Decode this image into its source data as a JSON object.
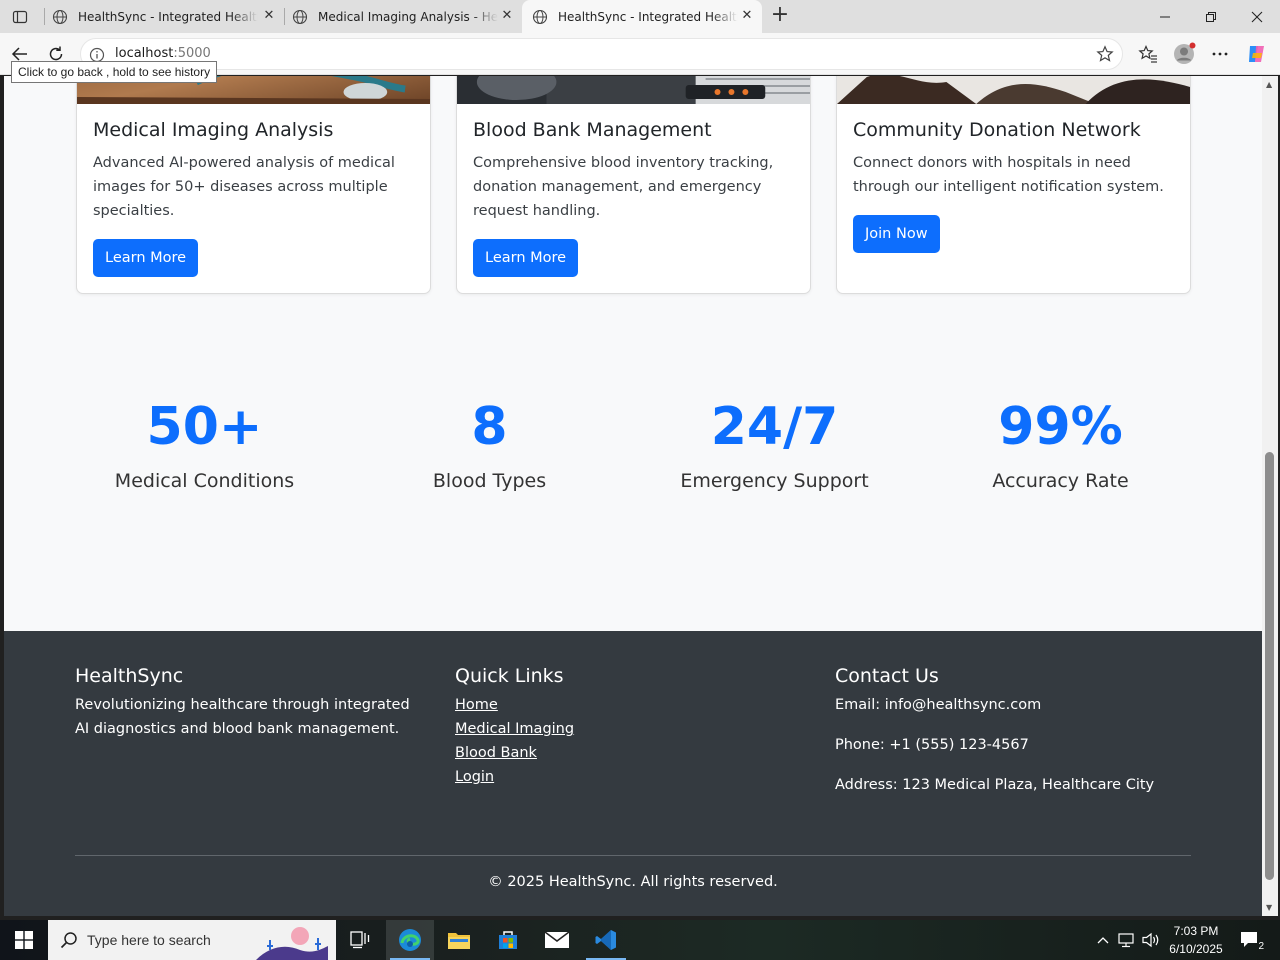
{
  "browser": {
    "tabs": [
      {
        "title": "HealthSync - Integrated Healthcare"
      },
      {
        "title": "Medical Imaging Analysis - HealthSync"
      },
      {
        "title": "HealthSync - Integrated Healthcare"
      }
    ],
    "url_host": "localhost",
    "url_port": ":5000",
    "back_tooltip": "Click to go back , hold to see history"
  },
  "cards": [
    {
      "title": "Medical Imaging Analysis",
      "text": "Advanced AI-powered analysis of medical images for 50+ diseases across multiple specialties.",
      "button": "Learn More"
    },
    {
      "title": "Blood Bank Management",
      "text": "Comprehensive blood inventory tracking, donation management, and emergency request handling.",
      "button": "Learn More"
    },
    {
      "title": "Community Donation Network",
      "text": "Connect donors with hospitals in need through our intelligent notification system.",
      "button": "Join Now"
    }
  ],
  "stats": [
    {
      "value": "50+",
      "label": "Medical Conditions"
    },
    {
      "value": "8",
      "label": "Blood Types"
    },
    {
      "value": "24/7",
      "label": "Emergency Support"
    },
    {
      "value": "99%",
      "label": "Accuracy Rate"
    }
  ],
  "footer": {
    "brand": "HealthSync",
    "tagline": "Revolutionizing healthcare through integrated AI diagnostics and blood bank management.",
    "quick_links_title": "Quick Links",
    "quick_links": [
      "Home",
      "Medical Imaging",
      "Blood Bank",
      "Login"
    ],
    "contact_title": "Contact Us",
    "email": "Email: info@healthsync.com",
    "phone": "Phone: +1 (555) 123-4567",
    "address": "Address: 123 Medical Plaza, Healthcare City",
    "copyright": "© 2025 HealthSync. All rights reserved."
  },
  "taskbar": {
    "search_placeholder": "Type here to search",
    "time": "7:03 PM",
    "date": "6/10/2025",
    "notification_count": "2"
  },
  "colors": {
    "primary": "#0d6efd",
    "footer_bg": "#343a40",
    "page_bg": "#f8f9fa"
  }
}
